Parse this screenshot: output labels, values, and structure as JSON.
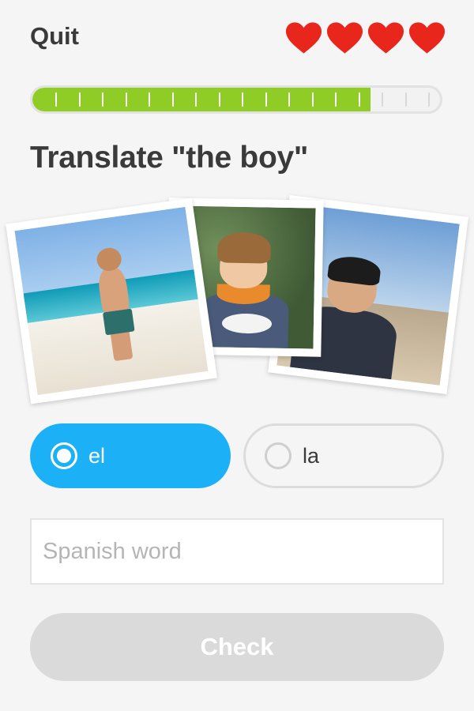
{
  "header": {
    "quit_label": "Quit",
    "hearts": [
      "heart-icon",
      "heart-icon",
      "heart-icon",
      "heart-icon"
    ],
    "heart_color": "#e8261c"
  },
  "progress": {
    "fraction": 0.83,
    "fill_color": "#8fcc25",
    "steps_total": 17,
    "steps_done": 14
  },
  "prompt": {
    "text": "Translate \"the boy\""
  },
  "photos": [
    "boy-at-beach-photo",
    "boy-with-scarf-photo",
    "smiling-boy-photo"
  ],
  "choices": [
    {
      "label": "el",
      "selected": true
    },
    {
      "label": "la",
      "selected": false
    }
  ],
  "input": {
    "placeholder": "Spanish word",
    "value": ""
  },
  "check_button": {
    "label": "Check",
    "enabled": false
  },
  "colors": {
    "accent_blue": "#1cb0f6",
    "progress_green": "#8fcc25",
    "disabled_gray": "#dadada"
  }
}
